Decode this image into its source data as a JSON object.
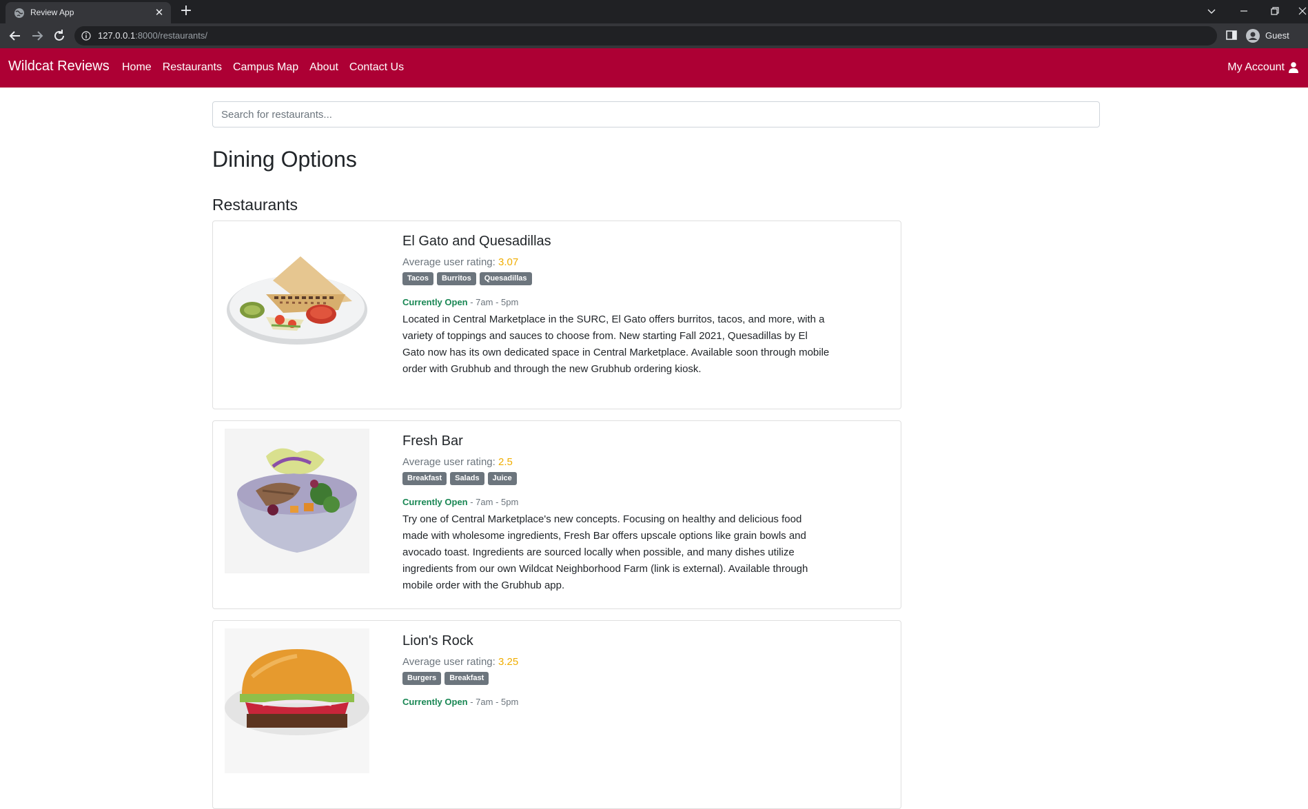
{
  "browser": {
    "tab_title": "Review App",
    "url_host": "127.0.0.1",
    "url_path": ":8000/restaurants/",
    "profile_label": "Guest",
    "icons": [
      "globe-icon",
      "close-icon",
      "plus-icon",
      "back-icon",
      "forward-icon",
      "reload-icon",
      "info-icon",
      "side-panel-icon",
      "profile-icon",
      "chevron-down-icon",
      "minimize-icon",
      "restore-icon",
      "window-close-icon"
    ]
  },
  "navbar": {
    "brand": "Wildcat Reviews",
    "links": [
      "Home",
      "Restaurants",
      "Campus Map",
      "About",
      "Contact Us"
    ],
    "account_label": "My Account",
    "account_icon": "user-icon",
    "color": "#ad0034"
  },
  "search": {
    "placeholder": "Search for restaurants..."
  },
  "page_title": "Dining Options",
  "section_title": "Restaurants",
  "rating_label": "Average user rating:",
  "restaurants": [
    {
      "name": "El Gato and Quesadillas",
      "rating": "3.07",
      "tags": [
        "Tacos",
        "Burritos",
        "Quesadillas"
      ],
      "status": "Currently Open",
      "hours": " - 7am - 5pm",
      "description": "Located in Central Marketplace in the SURC, El Gato offers burritos, tacos, and more, with a variety of toppings and sauces to choose from. New starting Fall 2021, Quesadillas by El Gato now has its own dedicated space in Central Marketplace. Available soon through mobile order with Grubhub and through the new Grubhub ordering kiosk.",
      "image": "quesadilla-plate-image"
    },
    {
      "name": "Fresh Bar",
      "rating": "2.5",
      "tags": [
        "Breakfast",
        "Salads",
        "Juice"
      ],
      "status": "Currently Open",
      "hours": " - 7am - 5pm",
      "description": "Try one of Central Marketplace's new concepts. Focusing on healthy and delicious food made with wholesome ingredients, Fresh Bar offers upscale options like grain bowls and avocado toast. Ingredients are sourced locally when possible, and many dishes utilize ingredients from our own Wildcat Neighborhood Farm (link is external). Available through mobile order with the Grubhub app.",
      "image": "grain-bowl-image"
    },
    {
      "name": "Lion's Rock",
      "rating": "3.25",
      "tags": [
        "Burgers",
        "Breakfast"
      ],
      "status": "Currently Open",
      "hours": " - 7am - 5pm",
      "description": "",
      "image": "burger-image"
    }
  ]
}
